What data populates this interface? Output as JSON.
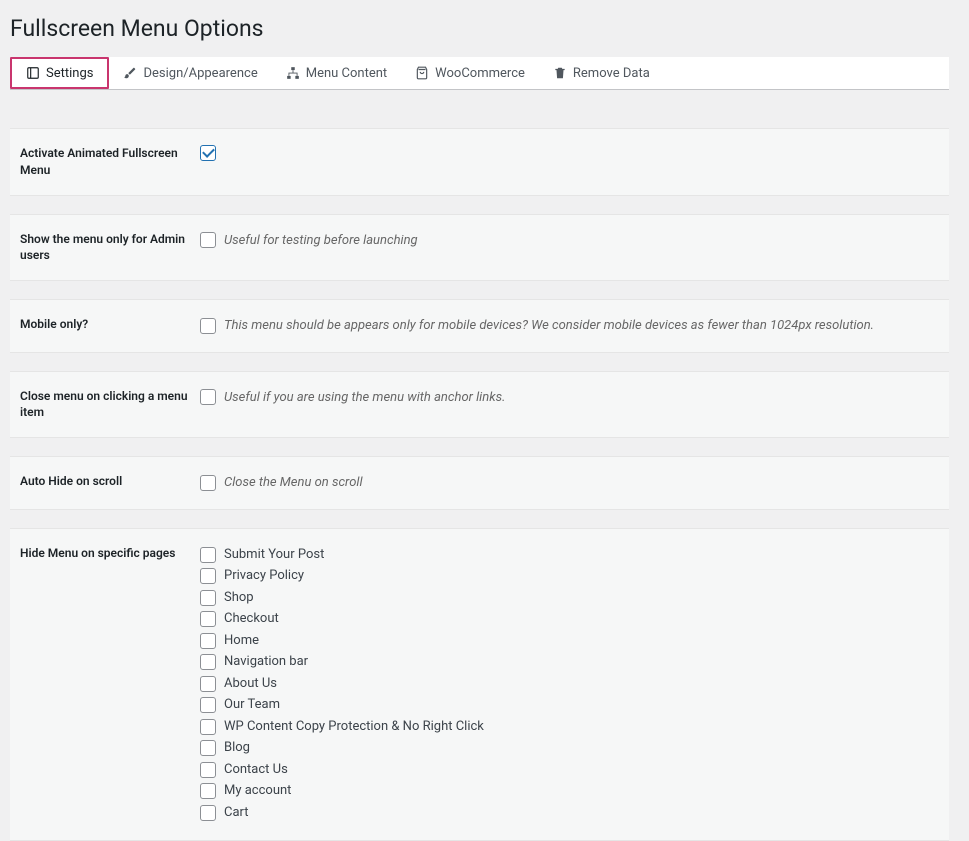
{
  "page": {
    "title": "Fullscreen Menu Options"
  },
  "tabs": {
    "settings": "Settings",
    "design": "Design/Appearence",
    "menu_content": "Menu Content",
    "woocommerce": "WooCommerce",
    "remove_data": "Remove Data"
  },
  "rows": {
    "activate": {
      "label": "Activate Animated Fullscreen Menu"
    },
    "admin_only": {
      "label": "Show the menu only for Admin users",
      "hint": "Useful for testing before launching"
    },
    "mobile_only": {
      "label": "Mobile only?",
      "hint": "This menu should be appears only for mobile devices? We consider mobile devices as fewer than 1024px resolution."
    },
    "close_on_click": {
      "label": "Close menu on clicking a menu item",
      "hint": "Useful if you are using the menu with anchor links."
    },
    "auto_hide": {
      "label": "Auto Hide on scroll",
      "hint": "Close the Menu on scroll"
    },
    "hide_pages": {
      "label": "Hide Menu on specific pages",
      "items": [
        "Submit Your Post",
        "Privacy Policy",
        "Shop",
        "Checkout",
        "Home",
        "Navigation bar",
        "About Us",
        "Our Team",
        "WP Content Copy Protection & No Right Click",
        "Blog",
        "Contact Us",
        "My account",
        "Cart"
      ]
    }
  }
}
